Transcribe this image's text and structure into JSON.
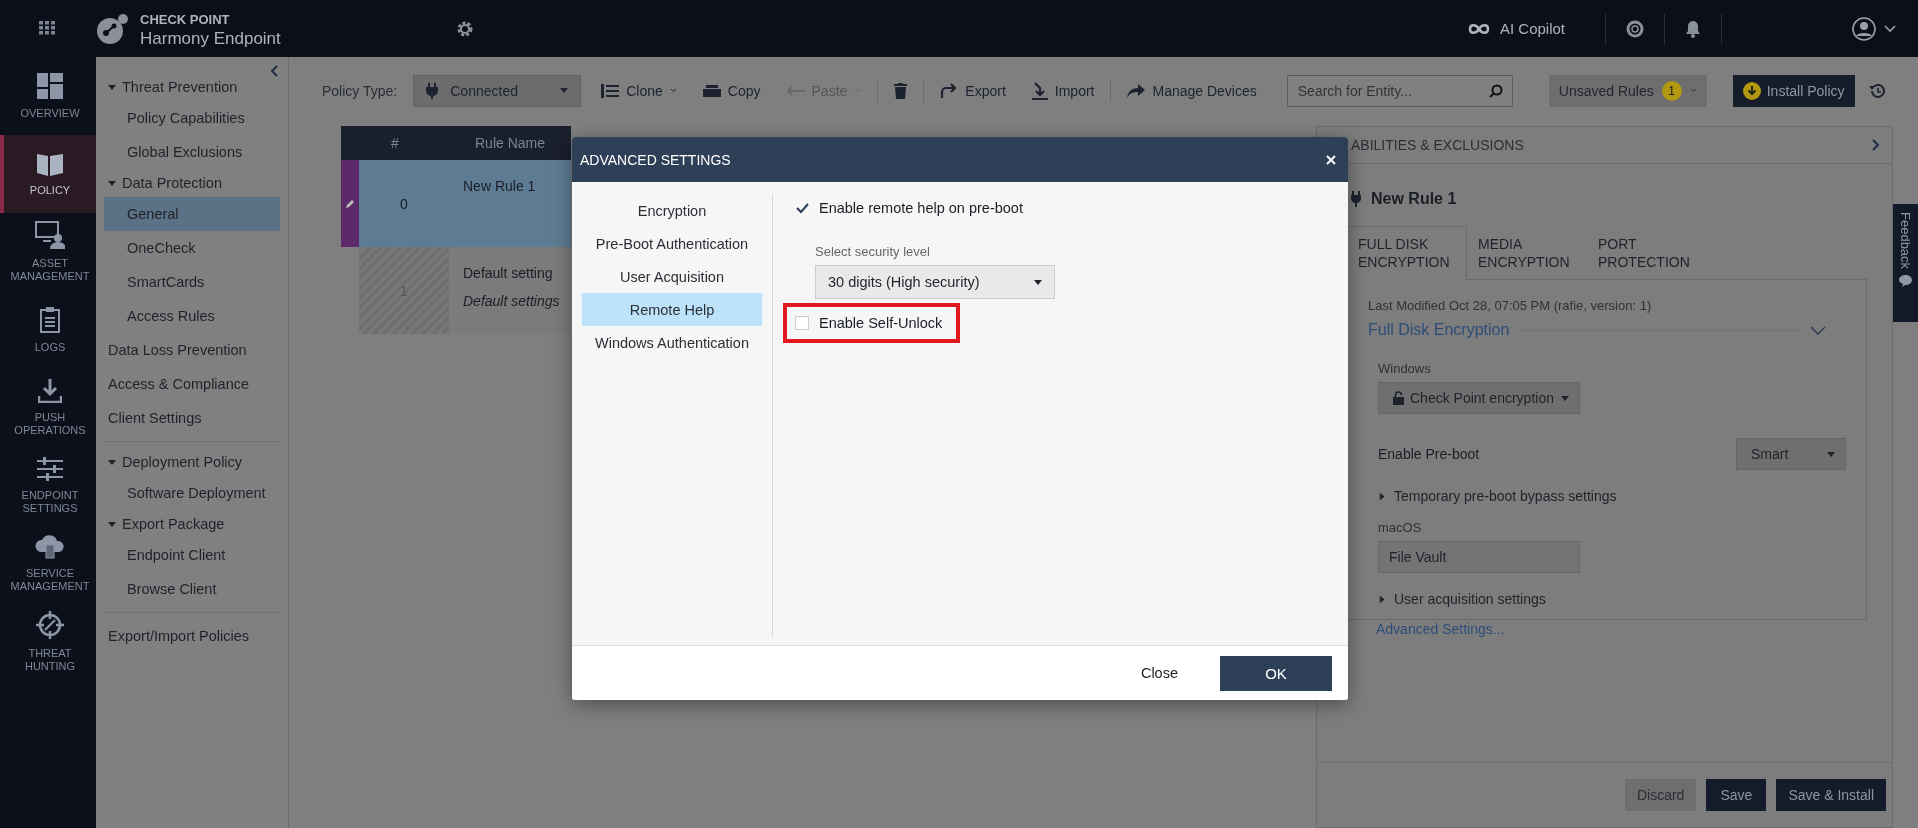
{
  "top_bar": {
    "brand_top": "CHECK POINT",
    "brand_bottom": "Harmony Endpoint",
    "copilot": "AI Copilot"
  },
  "rail": [
    {
      "label": "OVERVIEW",
      "kind": "overview",
      "selected": false
    },
    {
      "label": "POLICY",
      "kind": "policy",
      "selected": true
    },
    {
      "label": "ASSET MANAGEMENT",
      "kind": "asset",
      "selected": false
    },
    {
      "label": "LOGS",
      "kind": "logs",
      "selected": false
    },
    {
      "label": "PUSH OPERATIONS",
      "kind": "push",
      "selected": false
    },
    {
      "label": "ENDPOINT SETTINGS",
      "kind": "settings",
      "selected": false
    },
    {
      "label": "SERVICE MANAGEMENT",
      "kind": "service",
      "selected": false
    },
    {
      "label": "THREAT HUNTING",
      "kind": "hunting",
      "selected": false
    }
  ],
  "sub_nav": {
    "sections": [
      [
        {
          "label": "Threat Prevention",
          "expanded": true,
          "children": [
            {
              "label": "Policy Capabilities",
              "selected": false
            },
            {
              "label": "Global Exclusions",
              "selected": false
            }
          ]
        },
        {
          "label": "Data Protection",
          "expanded": true,
          "children": [
            {
              "label": "General",
              "selected": true
            },
            {
              "label": "OneCheck",
              "selected": false
            },
            {
              "label": "SmartCards",
              "selected": false
            },
            {
              "label": "Access Rules",
              "selected": false
            }
          ]
        },
        {
          "label": "Data Loss Prevention",
          "selected": false
        },
        {
          "label": "Access & Compliance",
          "selected": false
        },
        {
          "label": "Client Settings",
          "selected": false
        }
      ],
      [
        {
          "label": "Deployment Policy",
          "expanded": true,
          "children": [
            {
              "label": "Software Deployment",
              "selected": false
            }
          ]
        },
        {
          "label": "Export Package",
          "expanded": true,
          "children": [
            {
              "label": "Endpoint Client",
              "selected": false
            },
            {
              "label": "Browse Client",
              "selected": false
            }
          ]
        }
      ],
      [
        {
          "label": "Export/Import Policies",
          "selected": false
        }
      ]
    ]
  },
  "toolbar": {
    "policy_type_label": "Policy Type:",
    "policy_type": "Connected",
    "actions": [
      {
        "kind": "clone",
        "label": "Clone",
        "menu": true,
        "disabled": false
      },
      {
        "kind": "copy",
        "label": "Copy",
        "menu": false,
        "disabled": false
      },
      {
        "kind": "paste",
        "label": "Paste",
        "menu": true,
        "disabled": true
      },
      {
        "kind": "delete",
        "menu": false,
        "disabled": false
      },
      {
        "kind": "export",
        "label": "Export",
        "menu": false,
        "disabled": false
      },
      {
        "kind": "import",
        "label": "Import",
        "menu": false,
        "disabled": false
      },
      {
        "kind": "manage",
        "label": "Manage Devices",
        "menu": false,
        "disabled": false
      }
    ],
    "search_placeholder": "Search for Entity...",
    "unsaved_label": "Unsaved Rules",
    "unsaved_count": "1",
    "install": "Install Policy"
  },
  "rules_table": {
    "columns": [
      "#",
      "Rule Name"
    ],
    "rows": [
      {
        "kind": "rule",
        "number": "0",
        "name": "New Rule 1",
        "selected": true
      },
      {
        "kind": "default",
        "number": "1",
        "name": "Default setting",
        "comment": "Default settings",
        "selected": false
      }
    ]
  },
  "right_panel": {
    "header": "ABILITIES & EXCLUSIONS",
    "rule_title": "New Rule 1",
    "tabs": [
      {
        "label": "FULL DISK ENCRYPTION",
        "selected": true
      },
      {
        "label": "MEDIA ENCRYPTION",
        "selected": false
      },
      {
        "label": "PORT PROTECTION",
        "selected": false
      }
    ],
    "last_modified": "Last Modified Oct 28, 07:05 PM (rafie, version: 1)",
    "section_title": "Full Disk Encryption",
    "expanded": true,
    "windows_label": "Windows",
    "windows_value": "Check Point encryption",
    "preboot_label": "Enable Pre-boot",
    "preboot_value": "Smart",
    "bypass": "Temporary pre-boot bypass settings",
    "macos_label": "macOS",
    "macos_value": "File Vault",
    "user_acquisition": "User acquisition settings",
    "advanced_link": "Advanced Settings...",
    "buttons": [
      {
        "kind": "secondary",
        "label": "Discard"
      },
      {
        "kind": "primary",
        "label": "Save"
      },
      {
        "kind": "primary",
        "label": "Save & Install"
      }
    ]
  },
  "feedback": "Feedback",
  "dialog": {
    "title": "ADVANCED SETTINGS",
    "nav": [
      {
        "label": "Encryption",
        "selected": false
      },
      {
        "label": "Pre-Boot Authentication",
        "selected": false
      },
      {
        "label": "User Acquisition",
        "selected": false
      },
      {
        "label": "Remote Help",
        "selected": true
      },
      {
        "label": "Windows Authentication",
        "selected": false
      }
    ],
    "remote_help": {
      "label": "Enable remote help on pre-boot",
      "checked": true
    },
    "security_level_label": "Select security level",
    "security_level": "30 digits (High security)",
    "self_unlock": {
      "label": "Enable Self-Unlock",
      "checked": false,
      "highlighted": true
    },
    "close": "Close",
    "ok": "OK"
  }
}
